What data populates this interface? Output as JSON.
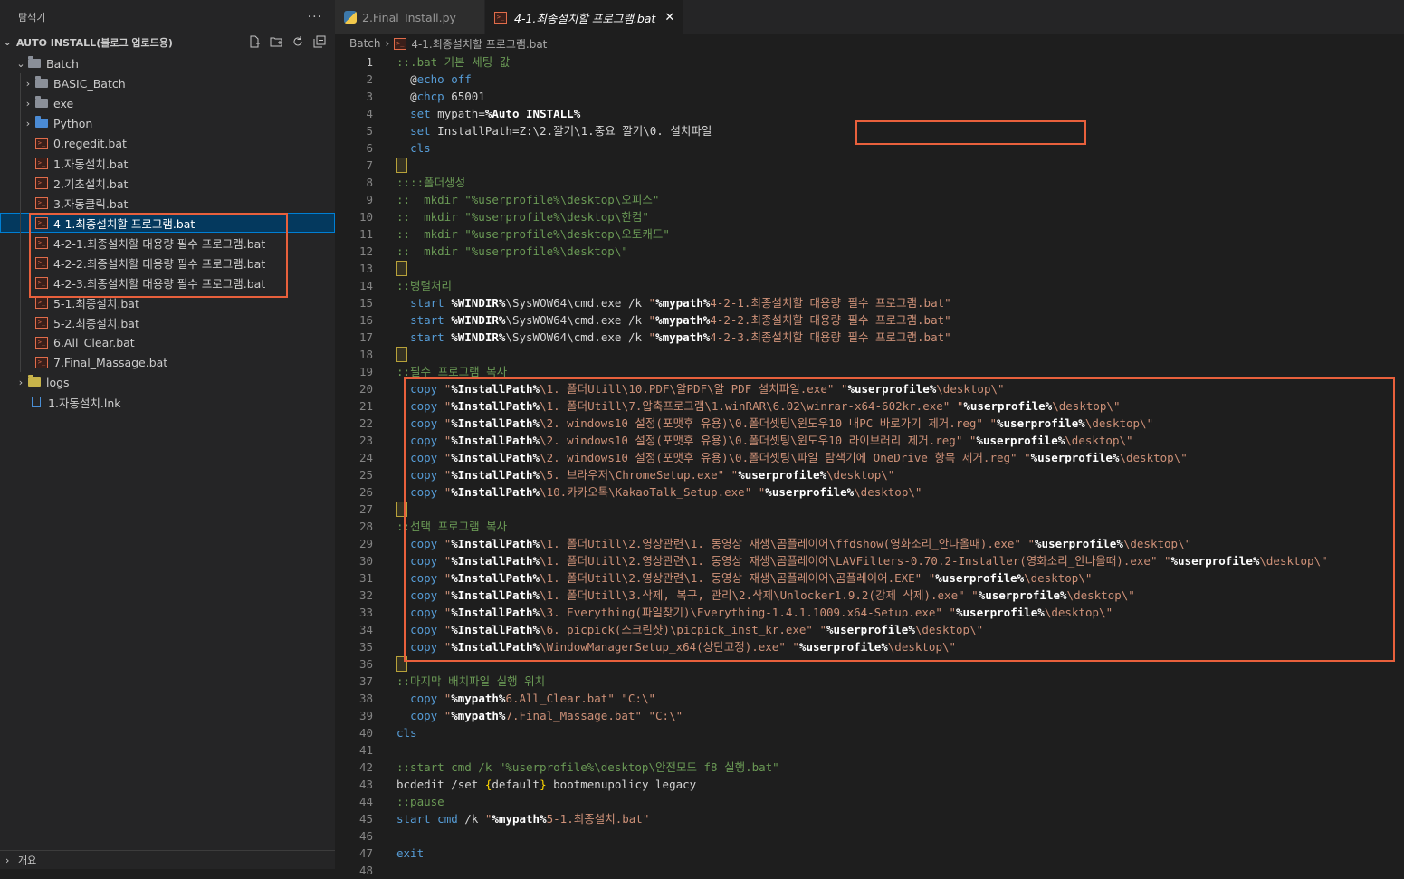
{
  "sidebar": {
    "title": "탐색기",
    "more": "···",
    "root_label": "AUTO INSTALL(블로그 업로드용)",
    "actions": [
      "new-file-icon",
      "new-folder-icon",
      "refresh-icon",
      "collapse-icon"
    ],
    "items": [
      {
        "label": "Batch",
        "type": "folder-open"
      },
      {
        "label": "BASIC_Batch",
        "type": "folder"
      },
      {
        "label": "exe",
        "type": "folder"
      },
      {
        "label": "Python",
        "type": "folder-python"
      },
      {
        "label": "0.regedit.bat",
        "type": "bat"
      },
      {
        "label": "1.자동설치.bat",
        "type": "bat"
      },
      {
        "label": "2.기초설치.bat",
        "type": "bat"
      },
      {
        "label": "3.자동클릭.bat",
        "type": "bat"
      },
      {
        "label": "4-1.최종설치할 프로그램.bat",
        "type": "bat",
        "selected": true
      },
      {
        "label": "4-2-1.최종설치할 대용량 필수 프로그램.bat",
        "type": "bat"
      },
      {
        "label": "4-2-2.최종설치할 대용량 필수 프로그램.bat",
        "type": "bat"
      },
      {
        "label": "4-2-3.최종설치할 대용량 필수 프로그램.bat",
        "type": "bat"
      },
      {
        "label": "5-1.최종설치.bat",
        "type": "bat"
      },
      {
        "label": "5-2.최종설치.bat",
        "type": "bat"
      },
      {
        "label": "6.All_Clear.bat",
        "type": "bat"
      },
      {
        "label": "7.Final_Massage.bat",
        "type": "bat"
      },
      {
        "label": "logs",
        "type": "folder-logs"
      },
      {
        "label": "1.자동설치.lnk",
        "type": "lnk"
      }
    ],
    "footer_label": "개요"
  },
  "tabs": [
    {
      "label": "2.Final_Install.py",
      "active": false
    },
    {
      "label": "4-1.최종설치할 프로그램.bat",
      "active": true
    }
  ],
  "breadcrumb": {
    "folder": "Batch",
    "file": "4-1.최종설치할 프로그램.bat"
  },
  "editor": {
    "current_line": 1,
    "lines": [
      {
        "n": 1,
        "t": "::.bat 기본 세팅 값"
      },
      {
        "n": 2,
        "t": "  @echo off"
      },
      {
        "n": 3,
        "t": "  @chcp 65001"
      },
      {
        "n": 4,
        "t": "  set mypath=%Auto INSTALL%"
      },
      {
        "n": 5,
        "t": "  set InstallPath=Z:\\2.깔기\\1.중요 깔기\\0. 설치파일"
      },
      {
        "n": 6,
        "t": "  cls"
      },
      {
        "n": 7,
        "t": ""
      },
      {
        "n": 8,
        "t": "::::폴더생성"
      },
      {
        "n": 9,
        "t": "::  mkdir \"%userprofile%\\desktop\\오피스\""
      },
      {
        "n": 10,
        "t": "::  mkdir \"%userprofile%\\desktop\\한컴\""
      },
      {
        "n": 11,
        "t": "::  mkdir \"%userprofile%\\desktop\\오토캐드\""
      },
      {
        "n": 12,
        "t": "::  mkdir \"%userprofile%\\desktop\\\""
      },
      {
        "n": 13,
        "t": ""
      },
      {
        "n": 14,
        "t": "::병렬처리"
      },
      {
        "n": 15,
        "t": "  start %WINDIR%\\SysWOW64\\cmd.exe /k \"%mypath%4-2-1.최종설치할 대용량 필수 프로그램.bat\""
      },
      {
        "n": 16,
        "t": "  start %WINDIR%\\SysWOW64\\cmd.exe /k \"%mypath%4-2-2.최종설치할 대용량 필수 프로그램.bat\""
      },
      {
        "n": 17,
        "t": "  start %WINDIR%\\SysWOW64\\cmd.exe /k \"%mypath%4-2-3.최종설치할 대용량 필수 프로그램.bat\""
      },
      {
        "n": 18,
        "t": ""
      },
      {
        "n": 19,
        "t": "::필수 프로그램 복사"
      },
      {
        "n": 20,
        "t": "  copy \"%InstallPath%\\1. 폴더Utill\\10.PDF\\알PDF\\알 PDF 설치파일.exe\" \"%userprofile%\\desktop\\\""
      },
      {
        "n": 21,
        "t": "  copy \"%InstallPath%\\1. 폴더Utill\\7.압축프로그램\\1.winRAR\\6.02\\winrar-x64-602kr.exe\" \"%userprofile%\\desktop\\\""
      },
      {
        "n": 22,
        "t": "  copy \"%InstallPath%\\2. windows10 설정(포맷후 유용)\\0.폴더셋팅\\윈도우10 내PC 바로가기 제거.reg\" \"%userprofile%\\desktop\\\""
      },
      {
        "n": 23,
        "t": "  copy \"%InstallPath%\\2. windows10 설정(포맷후 유용)\\0.폴더셋팅\\윈도우10 라이브러리 제거.reg\" \"%userprofile%\\desktop\\\""
      },
      {
        "n": 24,
        "t": "  copy \"%InstallPath%\\2. windows10 설정(포맷후 유용)\\0.폴더셋팅\\파일 탐색기에 OneDrive 항목 제거.reg\" \"%userprofile%\\desktop\\\""
      },
      {
        "n": 25,
        "t": "  copy \"%InstallPath%\\5. 브라우저\\ChromeSetup.exe\" \"%userprofile%\\desktop\\\""
      },
      {
        "n": 26,
        "t": "  copy \"%InstallPath%\\10.카카오톡\\KakaoTalk_Setup.exe\" \"%userprofile%\\desktop\\\""
      },
      {
        "n": 27,
        "t": ""
      },
      {
        "n": 28,
        "t": "::선택 프로그램 복사"
      },
      {
        "n": 29,
        "t": "  copy \"%InstallPath%\\1. 폴더Utill\\2.영상관련\\1. 동영상 재생\\곰플레이어\\ffdshow(영화소리_안나올때).exe\" \"%userprofile%\\desktop\\\""
      },
      {
        "n": 30,
        "t": "  copy \"%InstallPath%\\1. 폴더Utill\\2.영상관련\\1. 동영상 재생\\곰플레이어\\LAVFilters-0.70.2-Installer(영화소리_안나올때).exe\" \"%userprofile%\\desktop\\\""
      },
      {
        "n": 31,
        "t": "  copy \"%InstallPath%\\1. 폴더Utill\\2.영상관련\\1. 동영상 재생\\곰플레이어\\곰플레이어.EXE\" \"%userprofile%\\desktop\\\""
      },
      {
        "n": 32,
        "t": "  copy \"%InstallPath%\\1. 폴더Utill\\3.삭제, 복구, 관리\\2.삭제\\Unlocker1.9.2(강제 삭제).exe\" \"%userprofile%\\desktop\\\""
      },
      {
        "n": 33,
        "t": "  copy \"%InstallPath%\\3. Everything(파일찾기)\\Everything-1.4.1.1009.x64-Setup.exe\" \"%userprofile%\\desktop\\\""
      },
      {
        "n": 34,
        "t": "  copy \"%InstallPath%\\6. picpick(스크린샷)\\picpick_inst_kr.exe\" \"%userprofile%\\desktop\\\""
      },
      {
        "n": 35,
        "t": "  copy \"%InstallPath%\\WindowManagerSetup_x64(상단고정).exe\" \"%userprofile%\\desktop\\\""
      },
      {
        "n": 36,
        "t": ""
      },
      {
        "n": 37,
        "t": "::마지막 배치파일 실행 위치"
      },
      {
        "n": 38,
        "t": "  copy \"%mypath%6.All_Clear.bat\" \"C:\\\""
      },
      {
        "n": 39,
        "t": "  copy \"%mypath%7.Final_Massage.bat\" \"C:\\\""
      },
      {
        "n": 40,
        "t": "cls"
      },
      {
        "n": 41,
        "t": ""
      },
      {
        "n": 42,
        "t": "::start cmd /k \"%userprofile%\\desktop\\안전모드 f8 실행.bat\""
      },
      {
        "n": 43,
        "t": "bcdedit /set {default} bootmenupolicy legacy"
      },
      {
        "n": 44,
        "t": "::pause"
      },
      {
        "n": 45,
        "t": "start cmd /k \"%mypath%5-1.최종설치.bat\""
      },
      {
        "n": 46,
        "t": ""
      },
      {
        "n": 47,
        "t": "exit"
      },
      {
        "n": 48,
        "t": ""
      }
    ],
    "blank_markers": [
      7,
      13,
      18,
      27,
      36
    ]
  },
  "colors": {
    "highlight_box": "#e8603c",
    "selection": "#04395e",
    "comment": "#6a9955",
    "keyword": "#569cd6",
    "string": "#ce9178"
  }
}
